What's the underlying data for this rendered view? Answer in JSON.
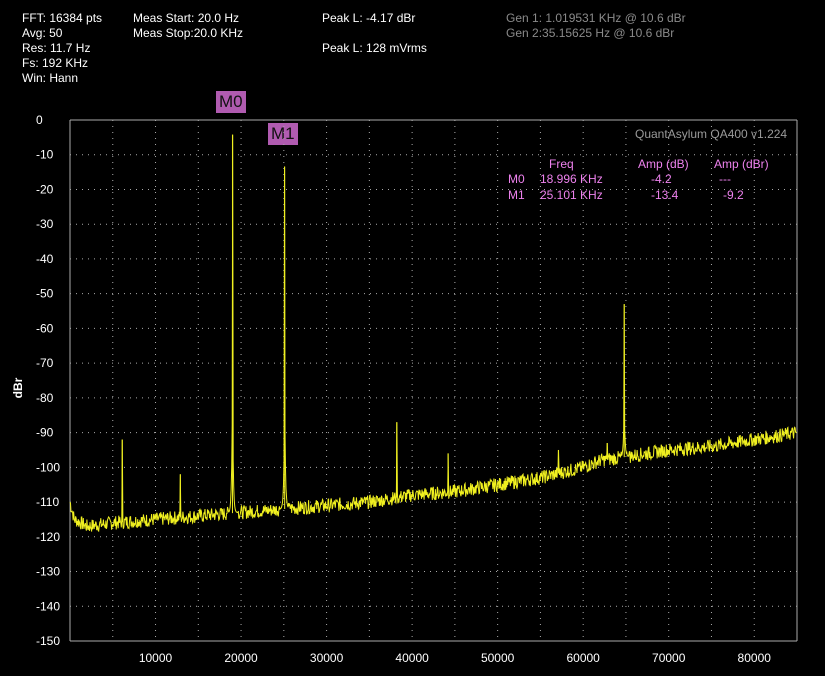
{
  "info": {
    "fft": "FFT: 16384 pts",
    "avg": "Avg: 50",
    "res": "Res: 11.7 Hz",
    "fs": "Fs: 192 KHz",
    "win": "Win: Hann",
    "meas_start": "Meas Start: 20.0 Hz",
    "meas_stop": "Meas Stop:20.0 KHz",
    "peak_db": "Peak L: -4.17 dBr",
    "peak_v": "Peak L: 128 mVrms",
    "gen1": "Gen 1: 1.019531 KHz @ 10.6  dBr",
    "gen2": "Gen 2:35.15625 Hz @ 10.6  dBr"
  },
  "watermark": "QuantAsylum QA400 v1.224",
  "markers": [
    {
      "label": "M0",
      "freq": "18.996 KHz",
      "amp_db": "-4.2",
      "amp_dbr": "---"
    },
    {
      "label": "M1",
      "freq": "25.101 KHz",
      "amp_db": "-13.4",
      "amp_dbr": "-9.2"
    }
  ],
  "marker_table_headers": {
    "freq": "Freq",
    "amp_db": "Amp (dB)",
    "amp_dbr": "Amp (dBr)"
  },
  "colors": {
    "trace": "#f0f020",
    "grid": "#aaaaaa",
    "marker": "#ee82ee",
    "marker_tag": "#b05bb0"
  },
  "chart_data": {
    "type": "line",
    "xlabel": "",
    "ylabel": "dBr",
    "xlim": [
      0,
      85000
    ],
    "ylim": [
      -150,
      0
    ],
    "x_ticks": [
      10000,
      20000,
      30000,
      40000,
      50000,
      60000,
      70000,
      80000
    ],
    "x_tick_labels": [
      "10000",
      "20000",
      "30000",
      "40000",
      "50000",
      "60000",
      "70000",
      "80000"
    ],
    "y_ticks": [
      0,
      -10,
      -20,
      -30,
      -40,
      -50,
      -60,
      -70,
      -80,
      -90,
      -100,
      -110,
      -120,
      -130,
      -140,
      -150
    ],
    "y_tick_labels": [
      "0",
      "-10",
      "-20",
      "-30",
      "-40",
      "-50",
      "-60",
      "-70",
      "-80",
      "-90",
      "-100",
      "-110",
      "-120",
      "-130",
      "-140",
      "-150"
    ],
    "grid": true,
    "noise_floor": [
      {
        "x": 0,
        "y": -110
      },
      {
        "x": 500,
        "y": -115
      },
      {
        "x": 2000,
        "y": -117
      },
      {
        "x": 5000,
        "y": -116
      },
      {
        "x": 10000,
        "y": -115
      },
      {
        "x": 15000,
        "y": -114
      },
      {
        "x": 20000,
        "y": -113
      },
      {
        "x": 25000,
        "y": -112
      },
      {
        "x": 30000,
        "y": -111
      },
      {
        "x": 35000,
        "y": -110
      },
      {
        "x": 40000,
        "y": -108
      },
      {
        "x": 45000,
        "y": -107
      },
      {
        "x": 50000,
        "y": -105
      },
      {
        "x": 55000,
        "y": -103
      },
      {
        "x": 60000,
        "y": -100
      },
      {
        "x": 62000,
        "y": -98
      },
      {
        "x": 65000,
        "y": -97
      },
      {
        "x": 70000,
        "y": -95
      },
      {
        "x": 75000,
        "y": -94
      },
      {
        "x": 80000,
        "y": -92
      },
      {
        "x": 85000,
        "y": -90
      }
    ],
    "peaks": [
      {
        "x": 6100,
        "y": -92
      },
      {
        "x": 12900,
        "y": -102
      },
      {
        "x": 18996,
        "y": -4.2
      },
      {
        "x": 25101,
        "y": -13.4
      },
      {
        "x": 38200,
        "y": -87
      },
      {
        "x": 44200,
        "y": -96
      },
      {
        "x": 57100,
        "y": -95
      },
      {
        "x": 62800,
        "y": -93
      },
      {
        "x": 64800,
        "y": -53
      }
    ]
  }
}
